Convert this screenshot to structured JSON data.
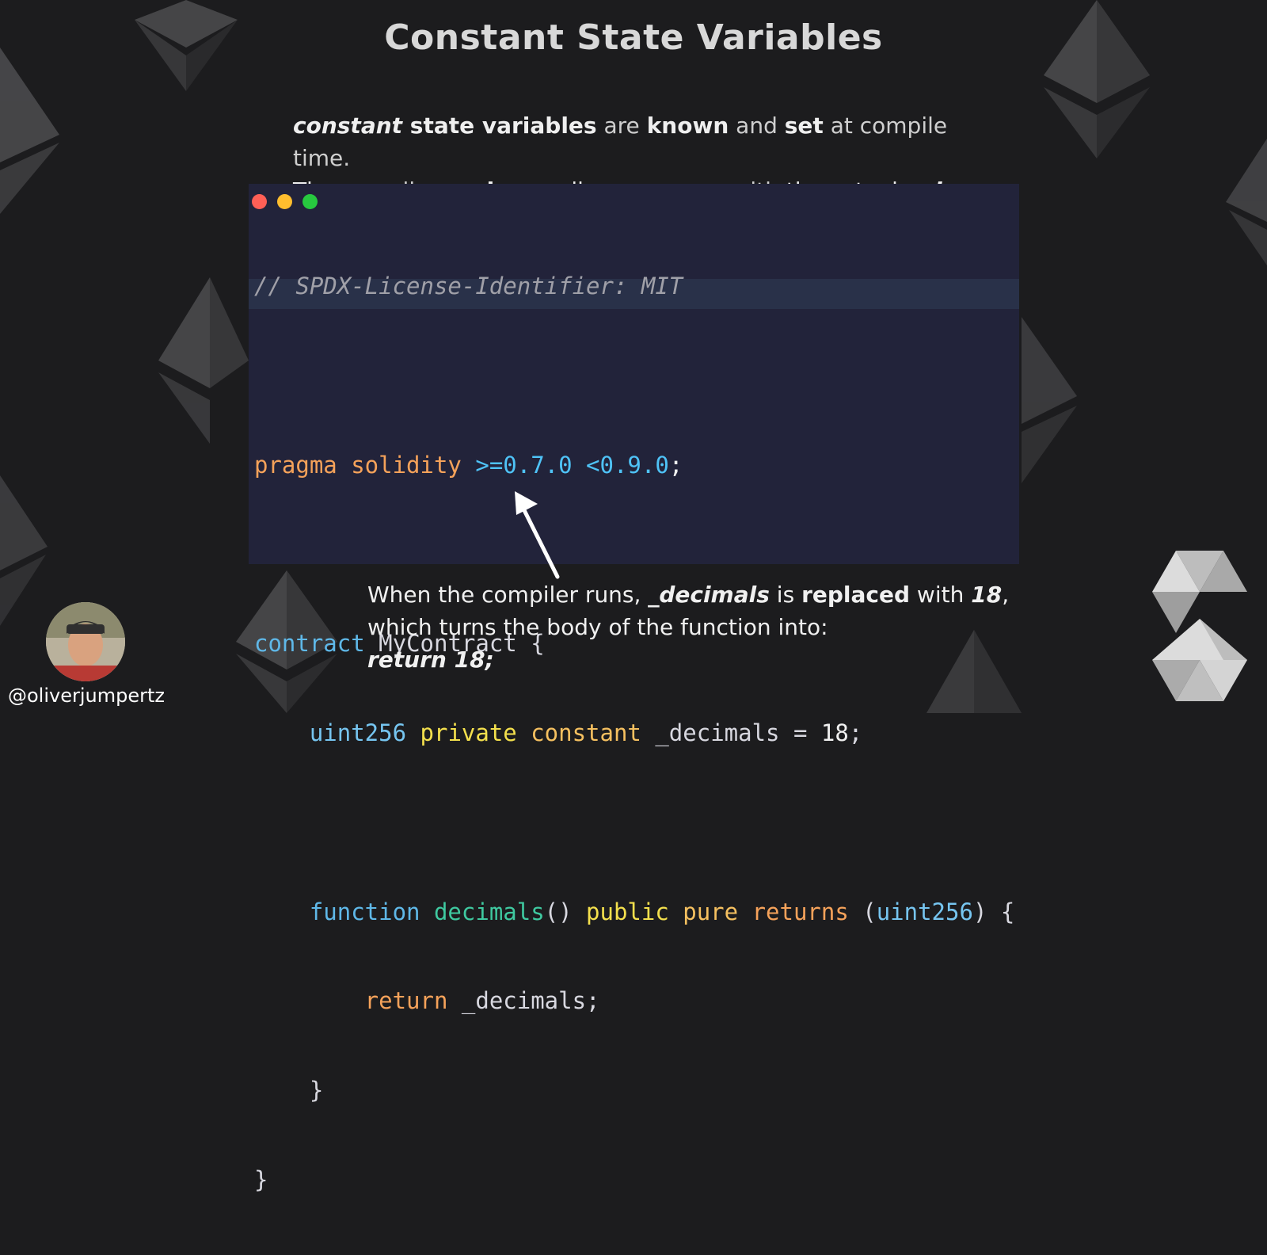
{
  "slide": {
    "title": "Constant State Variables",
    "intro": {
      "line1": {
        "p1": "constant",
        "p2": " state variables",
        "p3": " are ",
        "p4": "known",
        "p5": " and ",
        "p6": "set",
        "p7": " at compile time."
      },
      "line2": {
        "p1": "The",
        "p2": " compiler ",
        "p3": "replaces",
        "p4": " all",
        "p5": " occurrences with ",
        "p6": "the actual ",
        "p7": "value",
        "p8": "."
      }
    },
    "code": {
      "comment": "// SPDX-License-Identifier: MIT",
      "pragma_kw": "pragma solidity",
      "pragma_ver": " >=0.7.0 <0.9.0",
      "pragma_end": ";",
      "contract_kw": "contract",
      "contract_name": " MyContract {",
      "var_type": "    uint256",
      "var_private": " private",
      "var_constant": " constant",
      "var_rest": " _decimals = ",
      "var_num": "18",
      "var_end": ";",
      "fn_kw": "    function",
      "fn_name": " decimals",
      "fn_parens": "()",
      "fn_public": " public",
      "fn_pure": " pure",
      "fn_returns": " returns",
      "fn_open": " (",
      "fn_type": "uint256",
      "fn_close": ") {",
      "ret_kw": "        return",
      "ret_ident": " _decimals;",
      "close_inner": "    }",
      "close_outer": "}"
    },
    "note": {
      "l1": {
        "p1": "When the compiler runs, ",
        "p2": "_decimals",
        "p3": " is ",
        "p4": "replaced",
        "p5": " with ",
        "p6": "18",
        "p7": ","
      },
      "l2": "which turns the body of the function into:",
      "l3": "return 18;"
    },
    "author": {
      "handle": "@oliverjumpertz"
    },
    "colors": {
      "background": "#1c1c1e",
      "code_bg": "#22233a",
      "dot_red": "#ff5f56",
      "dot_yellow": "#ffbd2e",
      "dot_green": "#27c93f"
    },
    "icons": [
      "ethereum-logo-icon",
      "solidity-logo-icon",
      "arrow-icon"
    ]
  }
}
